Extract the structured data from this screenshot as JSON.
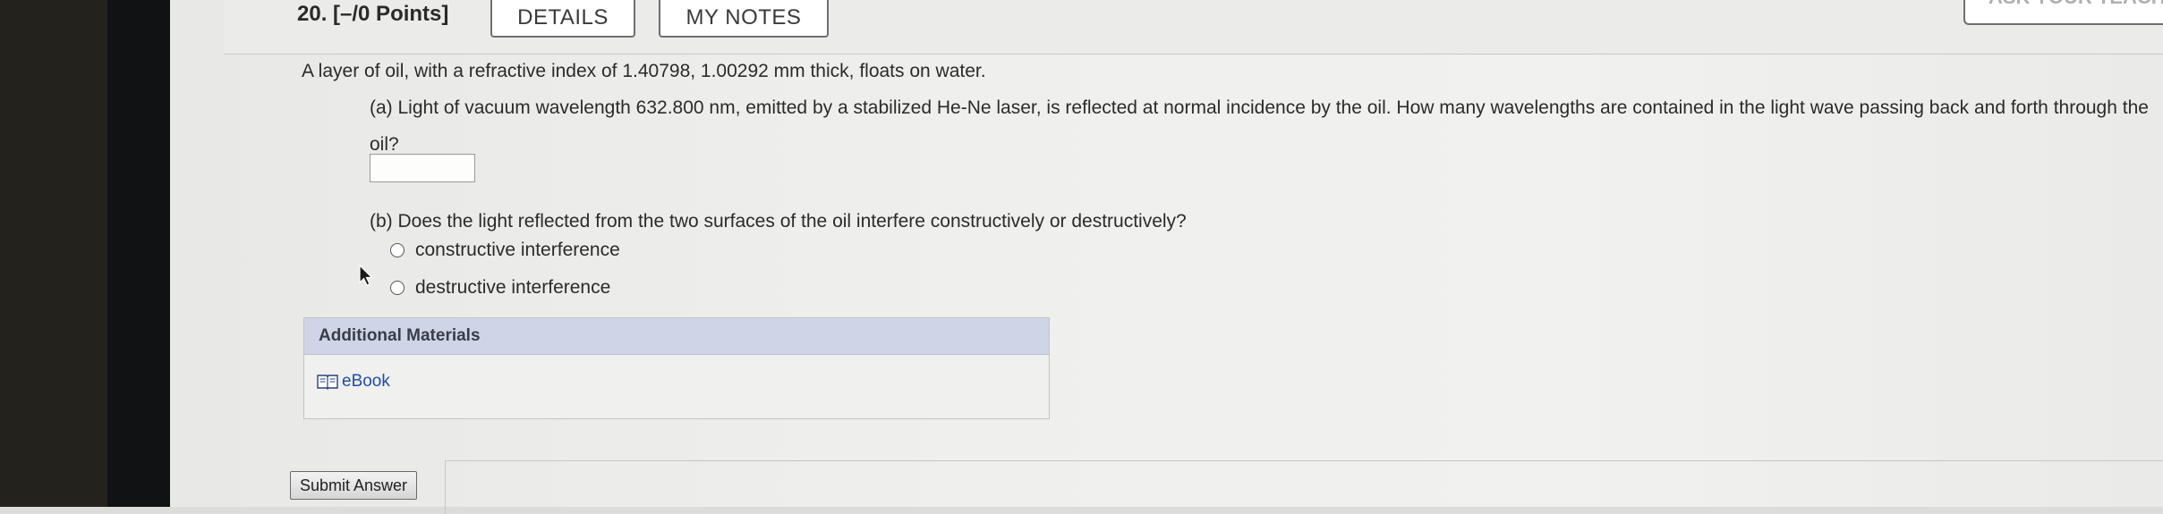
{
  "question": {
    "number_label": "20. [–/0 Points]",
    "tabs": {
      "details": "DETAILS",
      "my_notes": "MY NOTES"
    },
    "ask_teacher": "ASK YOUR TEACHER",
    "stem": "A layer of oil, with a refractive index of 1.40798, 1.00292 mm thick, floats on water.",
    "part_a": "(a) Light of vacuum wavelength 632.800 nm, emitted by a stabilized He-Ne laser, is reflected at normal incidence by the oil. How many wavelengths are contained in the light wave passing back and forth through the oil?",
    "answer_a_value": "",
    "part_b": "(b) Does the light reflected from the two surfaces of the oil interfere constructively or destructively?",
    "options": [
      "constructive interference",
      "destructive interference"
    ]
  },
  "materials": {
    "heading": "Additional Materials",
    "ebook_label": "eBook"
  },
  "submit_label": "Submit Answer",
  "colors": {
    "materials_header": "#cfd5e6",
    "link": "#1f4fa8"
  }
}
